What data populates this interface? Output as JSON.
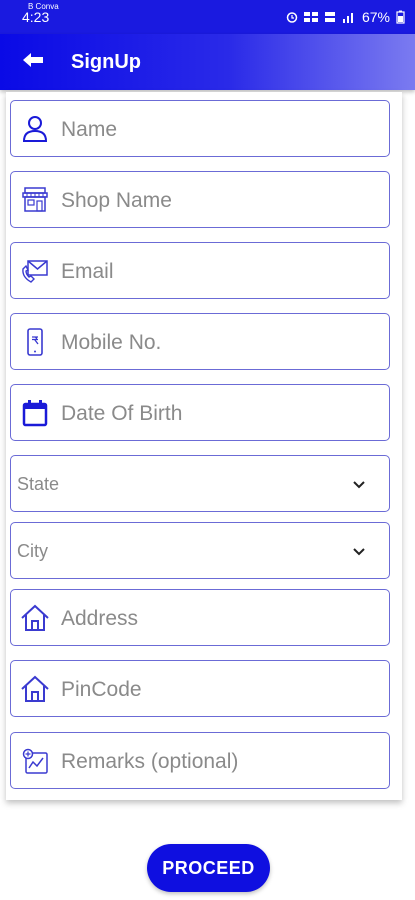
{
  "status_bar": {
    "carrier": "B Conva",
    "time": "4:23",
    "battery": "67%"
  },
  "app_bar": {
    "title": "SignUp",
    "back_icon": "back-arrow-icon"
  },
  "form": {
    "name": {
      "placeholder": "Name",
      "icon": "person-icon"
    },
    "shop_name": {
      "placeholder": "Shop Name",
      "icon": "shop-icon"
    },
    "email": {
      "placeholder": "Email",
      "icon": "email-phone-icon"
    },
    "mobile": {
      "placeholder": "Mobile No.",
      "icon": "mobile-icon"
    },
    "dob": {
      "placeholder": "Date Of Birth",
      "icon": "calendar-icon"
    },
    "state": {
      "selected": "State",
      "icon": "chevron-down-icon"
    },
    "city": {
      "selected": "City",
      "icon": "chevron-down-icon"
    },
    "address": {
      "placeholder": "Address",
      "icon": "home-icon"
    },
    "pincode": {
      "placeholder": "PinCode",
      "icon": "home-icon"
    },
    "remarks": {
      "placeholder": "Remarks (optional)",
      "icon": "remarks-icon"
    }
  },
  "actions": {
    "proceed_label": "PROCEED"
  },
  "colors": {
    "primary": "#1010e0",
    "field_border": "#6b6bd6",
    "placeholder": "#8a8a8a"
  }
}
